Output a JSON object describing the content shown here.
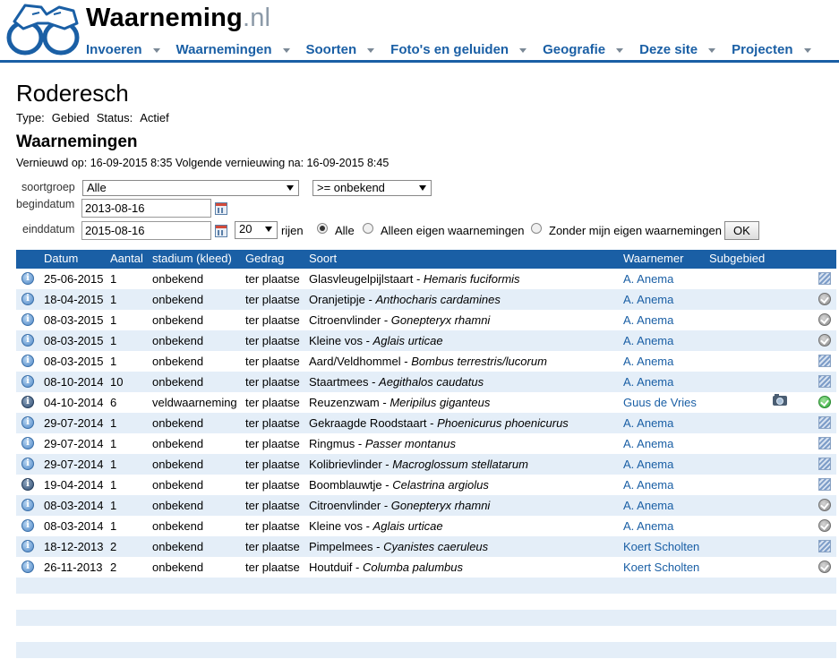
{
  "brand": {
    "name": "Waarneming",
    "tld": ".nl"
  },
  "nav": [
    {
      "label": "Invoeren"
    },
    {
      "label": "Waarnemingen"
    },
    {
      "label": "Soorten"
    },
    {
      "label": "Foto's en geluiden"
    },
    {
      "label": "Geografie"
    },
    {
      "label": "Deze site"
    },
    {
      "label": "Projecten"
    }
  ],
  "page": {
    "title": "Roderesch",
    "type_label": "Type:",
    "type_value": "Gebied",
    "status_label": "Status:",
    "status_value": "Actief",
    "section_title": "Waarnemingen",
    "refresh_text": "Vernieuwd op: 16-09-2015 8:35 Volgende vernieuwing na: 16-09-2015 8:45"
  },
  "filters": {
    "soortgroep_label": "soortgroep",
    "soortgroep_value": "Alle",
    "stadium_value": ">= onbekend",
    "begindatum_label": "begindatum",
    "begindatum_value": "2013-08-16",
    "einddatum_label": "einddatum",
    "einddatum_value": "2015-08-16",
    "rows_value": "20",
    "rows_label": "rijen",
    "radio_all": "Alle",
    "radio_own": "Alleen eigen waarnemingen",
    "radio_without": "Zonder mijn eigen waarnemingen",
    "ok_label": "OK"
  },
  "table": {
    "headers": {
      "date": "Datum",
      "count": "Aantal",
      "stage": "stadium (kleed)",
      "behaviour": "Gedrag",
      "species": "Soort",
      "observer": "Waarnemer",
      "subarea": "Subgebied"
    },
    "rows": [
      {
        "date": "25-06-2015",
        "count": "1",
        "stage": "onbekend",
        "behaviour": "ter plaatse",
        "name": "Glasvleugelpijlstaart",
        "sci": "Hemaris fuciformis",
        "observer": "A. Anema",
        "status": "hatch",
        "info": "light"
      },
      {
        "date": "18-04-2015",
        "count": "1",
        "stage": "onbekend",
        "behaviour": "ter plaatse",
        "name": "Oranjetipje",
        "sci": "Anthocharis cardamines",
        "observer": "A. Anema",
        "status": "grey",
        "info": "light"
      },
      {
        "date": "08-03-2015",
        "count": "1",
        "stage": "onbekend",
        "behaviour": "ter plaatse",
        "name": "Citroenvlinder",
        "sci": "Gonepteryx rhamni",
        "observer": "A. Anema",
        "status": "grey",
        "info": "light"
      },
      {
        "date": "08-03-2015",
        "count": "1",
        "stage": "onbekend",
        "behaviour": "ter plaatse",
        "name": "Kleine vos",
        "sci": "Aglais urticae",
        "observer": "A. Anema",
        "status": "grey",
        "info": "light"
      },
      {
        "date": "08-03-2015",
        "count": "1",
        "stage": "onbekend",
        "behaviour": "ter plaatse",
        "name": "Aard/Veldhommel",
        "sci": "Bombus terrestris/lucorum",
        "observer": "A. Anema",
        "status": "hatch",
        "info": "light"
      },
      {
        "date": "08-10-2014",
        "count": "10",
        "stage": "onbekend",
        "behaviour": "ter plaatse",
        "name": "Staartmees",
        "sci": "Aegithalos caudatus",
        "observer": "A. Anema",
        "status": "hatch",
        "info": "light"
      },
      {
        "date": "04-10-2014",
        "count": "6",
        "stage": "veldwaarneming",
        "behaviour": "ter plaatse",
        "name": "Reuzenzwam",
        "sci": "Meripilus giganteus",
        "observer": "Guus de Vries",
        "status": "green",
        "info": "dark",
        "camera": true
      },
      {
        "date": "29-07-2014",
        "count": "1",
        "stage": "onbekend",
        "behaviour": "ter plaatse",
        "name": "Gekraagde Roodstaart",
        "sci": "Phoenicurus phoenicurus",
        "observer": "A. Anema",
        "status": "hatch",
        "info": "light"
      },
      {
        "date": "29-07-2014",
        "count": "1",
        "stage": "onbekend",
        "behaviour": "ter plaatse",
        "name": "Ringmus",
        "sci": "Passer montanus",
        "observer": "A. Anema",
        "status": "hatch",
        "info": "light"
      },
      {
        "date": "29-07-2014",
        "count": "1",
        "stage": "onbekend",
        "behaviour": "ter plaatse",
        "name": "Kolibrievlinder",
        "sci": "Macroglossum stellatarum",
        "observer": "A. Anema",
        "status": "hatch",
        "info": "light"
      },
      {
        "date": "19-04-2014",
        "count": "1",
        "stage": "onbekend",
        "behaviour": "ter plaatse",
        "name": "Boomblauwtje",
        "sci": "Celastrina argiolus",
        "observer": "A. Anema",
        "status": "hatch",
        "info": "dark"
      },
      {
        "date": "08-03-2014",
        "count": "1",
        "stage": "onbekend",
        "behaviour": "ter plaatse",
        "name": "Citroenvlinder",
        "sci": "Gonepteryx rhamni",
        "observer": "A. Anema",
        "status": "grey",
        "info": "light"
      },
      {
        "date": "08-03-2014",
        "count": "1",
        "stage": "onbekend",
        "behaviour": "ter plaatse",
        "name": "Kleine vos",
        "sci": "Aglais urticae",
        "observer": "A. Anema",
        "status": "grey",
        "info": "light"
      },
      {
        "date": "18-12-2013",
        "count": "2",
        "stage": "onbekend",
        "behaviour": "ter plaatse",
        "name": "Pimpelmees",
        "sci": "Cyanistes caeruleus",
        "observer": "Koert Scholten",
        "status": "hatch",
        "info": "light"
      },
      {
        "date": "26-11-2013",
        "count": "2",
        "stage": "onbekend",
        "behaviour": "ter plaatse",
        "name": "Houtduif",
        "sci": "Columba palumbus",
        "observer": "Koert Scholten",
        "status": "grey",
        "info": "light"
      }
    ]
  },
  "colors": {
    "accent": "#1a5fa5",
    "row_alt": "#e4eef8"
  }
}
